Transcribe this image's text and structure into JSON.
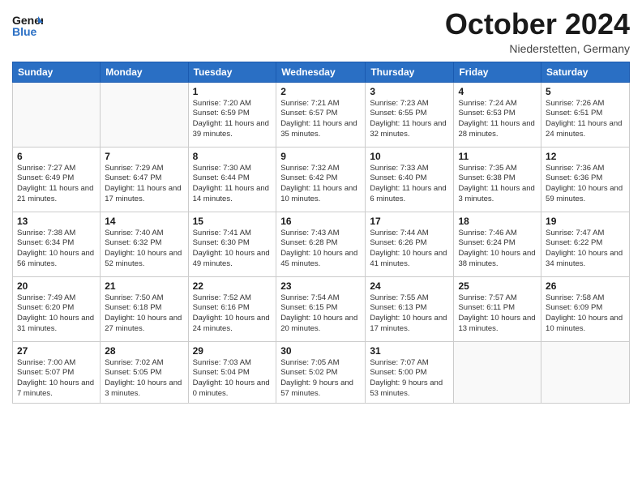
{
  "header": {
    "logo_general": "General",
    "logo_blue": "Blue",
    "title": "October 2024",
    "location": "Niederstetten, Germany"
  },
  "weekdays": [
    "Sunday",
    "Monday",
    "Tuesday",
    "Wednesday",
    "Thursday",
    "Friday",
    "Saturday"
  ],
  "weeks": [
    [
      {
        "day": "",
        "info": ""
      },
      {
        "day": "",
        "info": ""
      },
      {
        "day": "1",
        "info": "Sunrise: 7:20 AM\nSunset: 6:59 PM\nDaylight: 11 hours and 39 minutes."
      },
      {
        "day": "2",
        "info": "Sunrise: 7:21 AM\nSunset: 6:57 PM\nDaylight: 11 hours and 35 minutes."
      },
      {
        "day": "3",
        "info": "Sunrise: 7:23 AM\nSunset: 6:55 PM\nDaylight: 11 hours and 32 minutes."
      },
      {
        "day": "4",
        "info": "Sunrise: 7:24 AM\nSunset: 6:53 PM\nDaylight: 11 hours and 28 minutes."
      },
      {
        "day": "5",
        "info": "Sunrise: 7:26 AM\nSunset: 6:51 PM\nDaylight: 11 hours and 24 minutes."
      }
    ],
    [
      {
        "day": "6",
        "info": "Sunrise: 7:27 AM\nSunset: 6:49 PM\nDaylight: 11 hours and 21 minutes."
      },
      {
        "day": "7",
        "info": "Sunrise: 7:29 AM\nSunset: 6:47 PM\nDaylight: 11 hours and 17 minutes."
      },
      {
        "day": "8",
        "info": "Sunrise: 7:30 AM\nSunset: 6:44 PM\nDaylight: 11 hours and 14 minutes."
      },
      {
        "day": "9",
        "info": "Sunrise: 7:32 AM\nSunset: 6:42 PM\nDaylight: 11 hours and 10 minutes."
      },
      {
        "day": "10",
        "info": "Sunrise: 7:33 AM\nSunset: 6:40 PM\nDaylight: 11 hours and 6 minutes."
      },
      {
        "day": "11",
        "info": "Sunrise: 7:35 AM\nSunset: 6:38 PM\nDaylight: 11 hours and 3 minutes."
      },
      {
        "day": "12",
        "info": "Sunrise: 7:36 AM\nSunset: 6:36 PM\nDaylight: 10 hours and 59 minutes."
      }
    ],
    [
      {
        "day": "13",
        "info": "Sunrise: 7:38 AM\nSunset: 6:34 PM\nDaylight: 10 hours and 56 minutes."
      },
      {
        "day": "14",
        "info": "Sunrise: 7:40 AM\nSunset: 6:32 PM\nDaylight: 10 hours and 52 minutes."
      },
      {
        "day": "15",
        "info": "Sunrise: 7:41 AM\nSunset: 6:30 PM\nDaylight: 10 hours and 49 minutes."
      },
      {
        "day": "16",
        "info": "Sunrise: 7:43 AM\nSunset: 6:28 PM\nDaylight: 10 hours and 45 minutes."
      },
      {
        "day": "17",
        "info": "Sunrise: 7:44 AM\nSunset: 6:26 PM\nDaylight: 10 hours and 41 minutes."
      },
      {
        "day": "18",
        "info": "Sunrise: 7:46 AM\nSunset: 6:24 PM\nDaylight: 10 hours and 38 minutes."
      },
      {
        "day": "19",
        "info": "Sunrise: 7:47 AM\nSunset: 6:22 PM\nDaylight: 10 hours and 34 minutes."
      }
    ],
    [
      {
        "day": "20",
        "info": "Sunrise: 7:49 AM\nSunset: 6:20 PM\nDaylight: 10 hours and 31 minutes."
      },
      {
        "day": "21",
        "info": "Sunrise: 7:50 AM\nSunset: 6:18 PM\nDaylight: 10 hours and 27 minutes."
      },
      {
        "day": "22",
        "info": "Sunrise: 7:52 AM\nSunset: 6:16 PM\nDaylight: 10 hours and 24 minutes."
      },
      {
        "day": "23",
        "info": "Sunrise: 7:54 AM\nSunset: 6:15 PM\nDaylight: 10 hours and 20 minutes."
      },
      {
        "day": "24",
        "info": "Sunrise: 7:55 AM\nSunset: 6:13 PM\nDaylight: 10 hours and 17 minutes."
      },
      {
        "day": "25",
        "info": "Sunrise: 7:57 AM\nSunset: 6:11 PM\nDaylight: 10 hours and 13 minutes."
      },
      {
        "day": "26",
        "info": "Sunrise: 7:58 AM\nSunset: 6:09 PM\nDaylight: 10 hours and 10 minutes."
      }
    ],
    [
      {
        "day": "27",
        "info": "Sunrise: 7:00 AM\nSunset: 5:07 PM\nDaylight: 10 hours and 7 minutes."
      },
      {
        "day": "28",
        "info": "Sunrise: 7:02 AM\nSunset: 5:05 PM\nDaylight: 10 hours and 3 minutes."
      },
      {
        "day": "29",
        "info": "Sunrise: 7:03 AM\nSunset: 5:04 PM\nDaylight: 10 hours and 0 minutes."
      },
      {
        "day": "30",
        "info": "Sunrise: 7:05 AM\nSunset: 5:02 PM\nDaylight: 9 hours and 57 minutes."
      },
      {
        "day": "31",
        "info": "Sunrise: 7:07 AM\nSunset: 5:00 PM\nDaylight: 9 hours and 53 minutes."
      },
      {
        "day": "",
        "info": ""
      },
      {
        "day": "",
        "info": ""
      }
    ]
  ]
}
